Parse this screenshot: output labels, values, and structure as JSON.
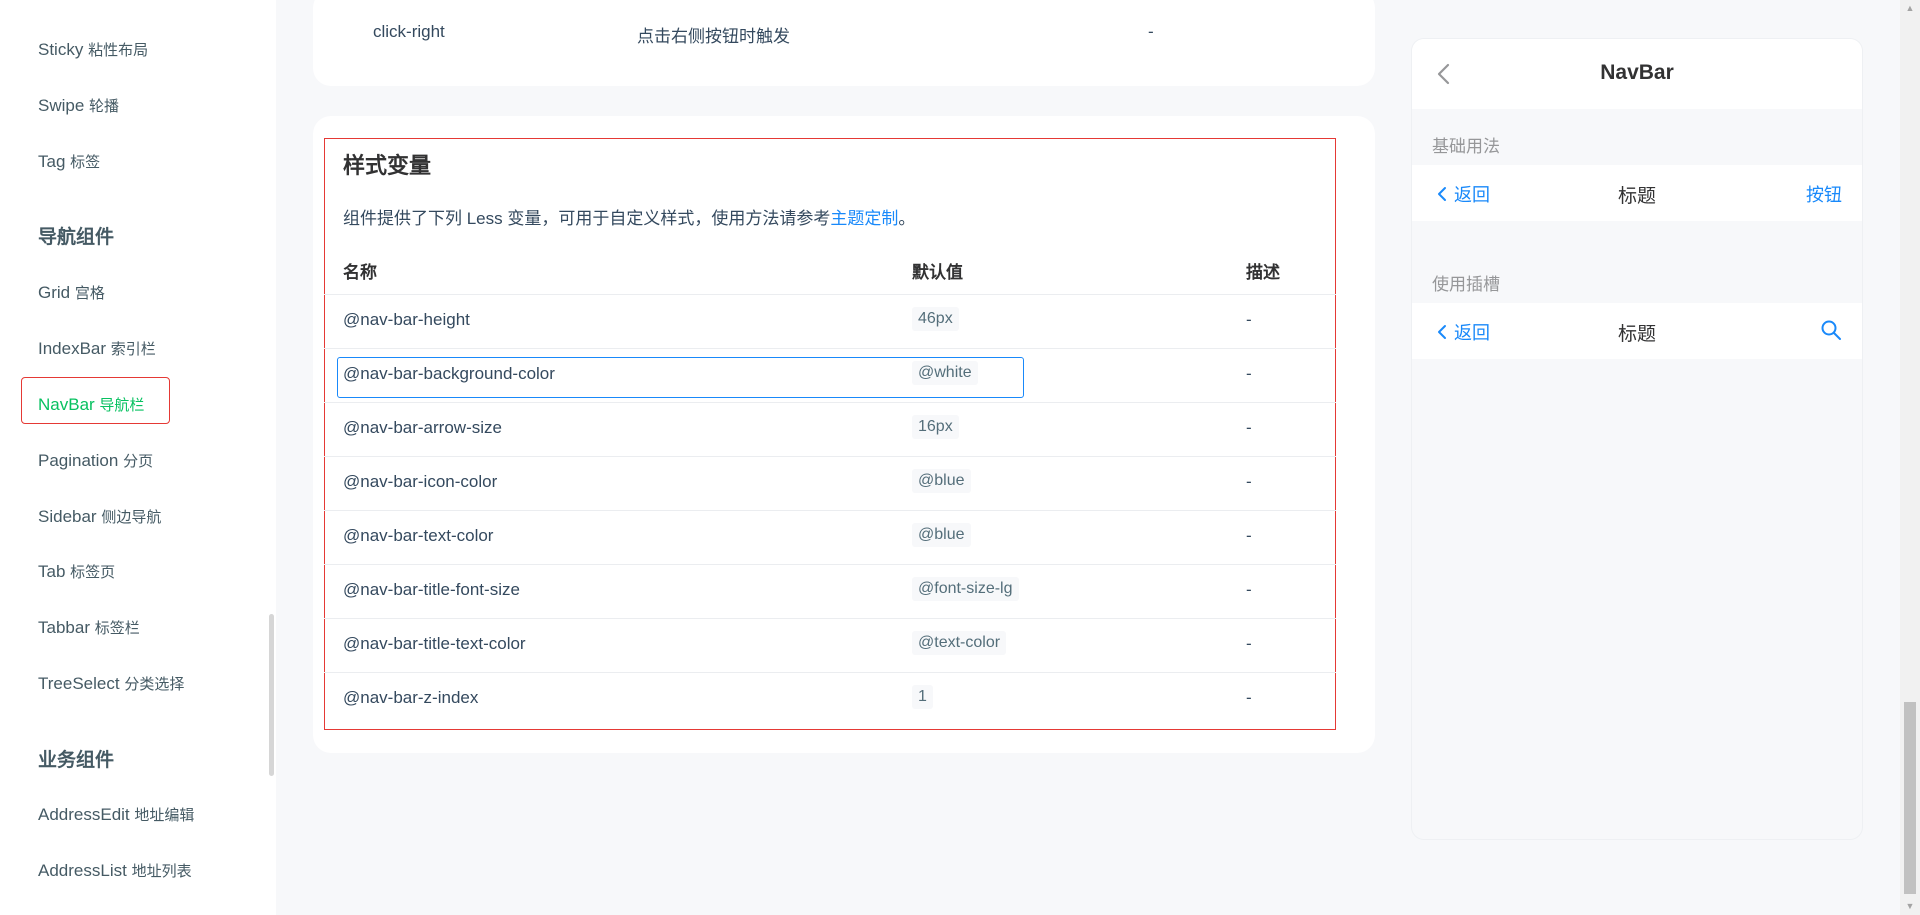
{
  "sidebar": {
    "items": [
      {
        "en": "Sticky",
        "zh": "粘性布局",
        "active": false
      },
      {
        "en": "Swipe",
        "zh": "轮播",
        "active": false
      },
      {
        "en": "Tag",
        "zh": "标签",
        "active": false
      },
      {
        "group": "导航组件"
      },
      {
        "en": "Grid",
        "zh": "宫格",
        "active": false
      },
      {
        "en": "IndexBar",
        "zh": "索引栏",
        "active": false
      },
      {
        "en": "NavBar",
        "zh": "导航栏",
        "active": true
      },
      {
        "en": "Pagination",
        "zh": "分页",
        "active": false
      },
      {
        "en": "Sidebar",
        "zh": "侧边导航",
        "active": false
      },
      {
        "en": "Tab",
        "zh": "标签页",
        "active": false
      },
      {
        "en": "Tabbar",
        "zh": "标签栏",
        "active": false
      },
      {
        "en": "TreeSelect",
        "zh": "分类选择",
        "active": false
      },
      {
        "group": "业务组件"
      },
      {
        "en": "AddressEdit",
        "zh": "地址编辑",
        "active": false
      },
      {
        "en": "AddressList",
        "zh": "地址列表",
        "active": false
      }
    ]
  },
  "events": {
    "row": {
      "name": "click-right",
      "desc": "点击右侧按钮时触发",
      "args": "-"
    }
  },
  "styles": {
    "title": "样式变量",
    "desc_prefix": "组件提供了下列 Less 变量，可用于自定义样式，使用方法请参考",
    "desc_link": "主题定制",
    "desc_suffix": "。",
    "headers": {
      "name": "名称",
      "default": "默认值",
      "desc": "描述"
    },
    "rows": [
      {
        "name": "@nav-bar-height",
        "default": "46px",
        "desc": "-"
      },
      {
        "name": "@nav-bar-background-color",
        "default": "@white",
        "desc": "-"
      },
      {
        "name": "@nav-bar-arrow-size",
        "default": "16px",
        "desc": "-"
      },
      {
        "name": "@nav-bar-icon-color",
        "default": "@blue",
        "desc": "-"
      },
      {
        "name": "@nav-bar-text-color",
        "default": "@blue",
        "desc": "-"
      },
      {
        "name": "@nav-bar-title-font-size",
        "default": "@font-size-lg",
        "desc": "-"
      },
      {
        "name": "@nav-bar-title-text-color",
        "default": "@text-color",
        "desc": "-"
      },
      {
        "name": "@nav-bar-z-index",
        "default": "1",
        "desc": "-"
      }
    ]
  },
  "simulator": {
    "title": "NavBar",
    "section1": "基础用法",
    "section2": "使用插槽",
    "back": "返回",
    "nav_title": "标题",
    "right_button": "按钮"
  },
  "colors": {
    "accent": "#1989fa",
    "active": "#07c160",
    "highlight": "#e53935"
  }
}
